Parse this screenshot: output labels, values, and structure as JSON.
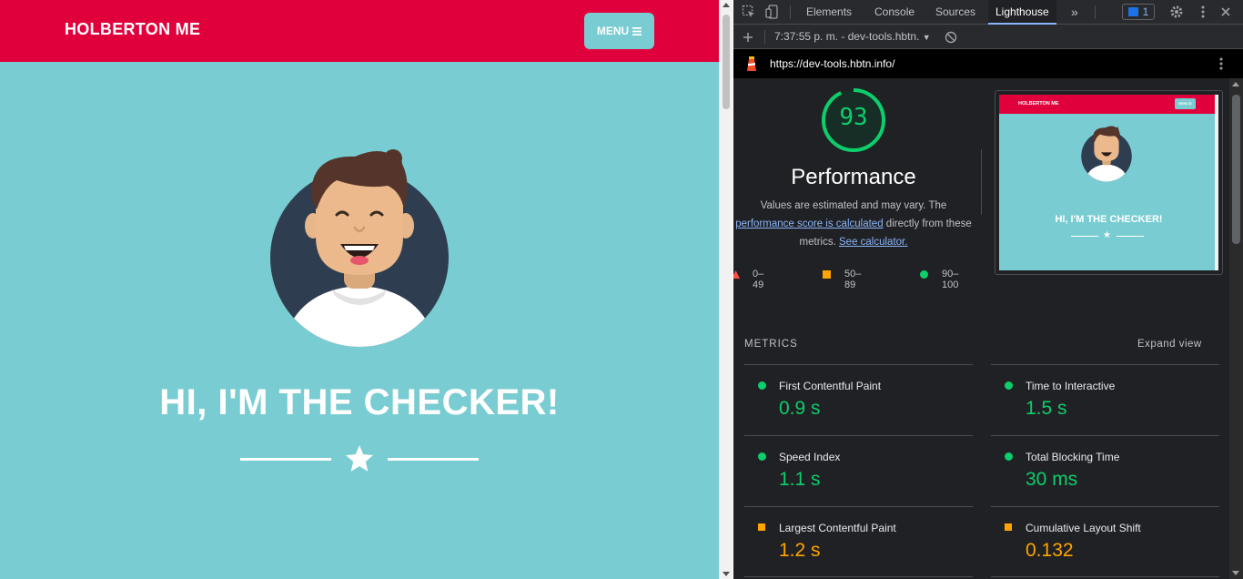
{
  "page": {
    "brand": "HOLBERTON ME",
    "menu_label": "MENU",
    "hero_title": "HI, I'M THE CHECKER!",
    "colors": {
      "nav": "#e0003c",
      "hero_bg": "#79cdd2"
    }
  },
  "devtools": {
    "tabs": [
      "Elements",
      "Console",
      "Sources",
      "Lighthouse"
    ],
    "active_tab": "Lighthouse",
    "more_tabs_icon": "»",
    "issues_count": "1",
    "report_select": "7:37:55 p. m. - dev-tools.hbtn.",
    "url": "https://dev-tools.hbtn.info/"
  },
  "report": {
    "score": "93",
    "category": "Performance",
    "desc_part1": "Values are estimated and may vary. The",
    "desc_link1": "performance score is calculated",
    "desc_part2": "directly from these metrics.",
    "desc_link2": "See calculator.",
    "legend": [
      {
        "label": "0–49",
        "color": "#ff4e42",
        "shape": "triangle"
      },
      {
        "label": "50–89",
        "color": "#ffa400",
        "shape": "square"
      },
      {
        "label": "90–100",
        "color": "#0cce6b",
        "shape": "circle"
      }
    ],
    "thumb": {
      "brand": "HOLBERTON ME",
      "menu": "MENU ☰",
      "title": "HI, I'M THE CHECKER!"
    },
    "metrics_title": "METRICS",
    "expand_label": "Expand view",
    "metrics": [
      {
        "label": "First Contentful Paint",
        "value": "0.9 s",
        "status": "pass"
      },
      {
        "label": "Time to Interactive",
        "value": "1.5 s",
        "status": "pass"
      },
      {
        "label": "Speed Index",
        "value": "1.1 s",
        "status": "pass"
      },
      {
        "label": "Total Blocking Time",
        "value": "30 ms",
        "status": "pass"
      },
      {
        "label": "Largest Contentful Paint",
        "value": "1.2 s",
        "status": "avg"
      },
      {
        "label": "Cumulative Layout Shift",
        "value": "0.132",
        "status": "avg"
      }
    ]
  }
}
